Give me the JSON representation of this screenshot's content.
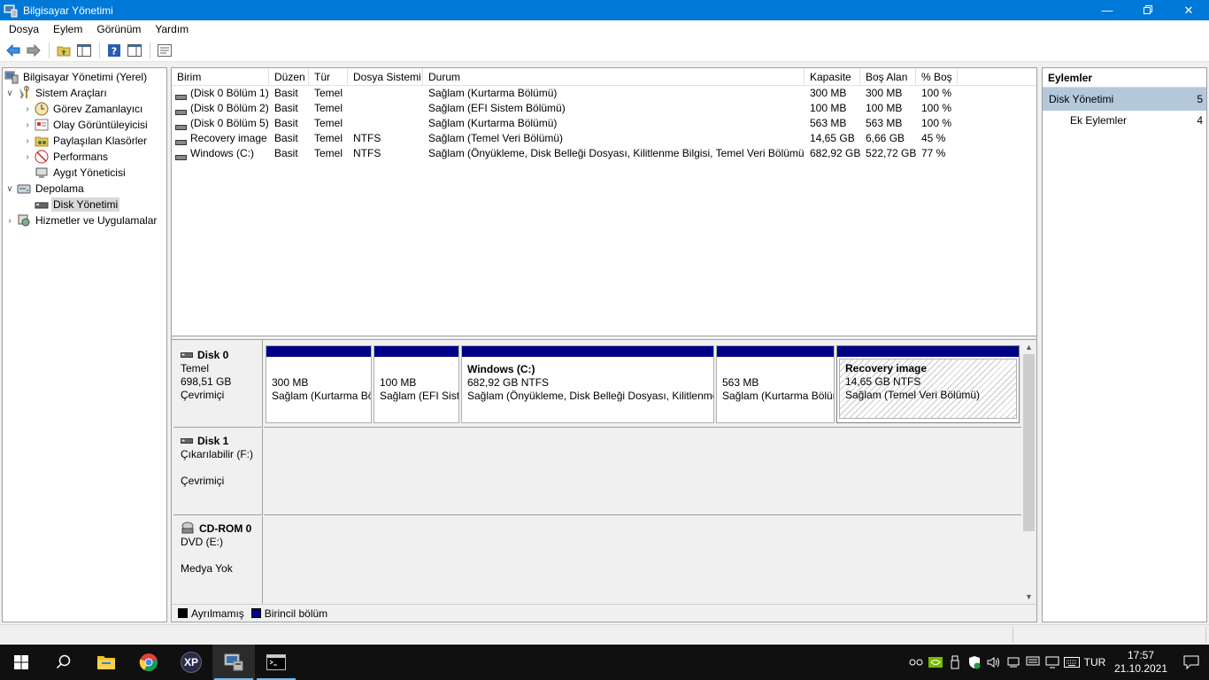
{
  "window": {
    "title": "Bilgisayar Yönetimi",
    "controls": [
      "minimize",
      "restore",
      "close"
    ]
  },
  "menu": [
    "Dosya",
    "Eylem",
    "Görünüm",
    "Yardım"
  ],
  "toolbar": {
    "buttons": [
      "back-icon",
      "forward-icon",
      "up-folder-icon",
      "show-hide-tree-icon",
      "help-icon",
      "show-hide-action-pane-icon",
      "properties-icon"
    ]
  },
  "tree": {
    "root": "Bilgisayar Yönetimi (Yerel)",
    "system_tools": "Sistem Araçları",
    "task_scheduler": "Görev Zamanlayıcı",
    "event_viewer": "Olay Görüntüleyicisi",
    "shared_folders": "Paylaşılan Klasörler",
    "performance": "Performans",
    "device_manager": "Aygıt Yöneticisi",
    "storage": "Depolama",
    "disk_management": "Disk Yönetimi",
    "services_apps": "Hizmetler ve Uygulamalar"
  },
  "volumes": {
    "headers": [
      "Birim",
      "Düzen",
      "Tür",
      "Dosya Sistemi",
      "Durum",
      "Kapasite",
      "Boş Alan",
      "% Boş"
    ],
    "rows": [
      [
        "(Disk 0 Bölüm 1)",
        "Basit",
        "Temel",
        "",
        "Sağlam (Kurtarma Bölümü)",
        "300 MB",
        "300 MB",
        "100 %"
      ],
      [
        "(Disk 0 Bölüm 2)",
        "Basit",
        "Temel",
        "",
        "Sağlam (EFI Sistem Bölümü)",
        "100 MB",
        "100 MB",
        "100 %"
      ],
      [
        "(Disk 0 Bölüm 5)",
        "Basit",
        "Temel",
        "",
        "Sağlam (Kurtarma Bölümü)",
        "563 MB",
        "563 MB",
        "100 %"
      ],
      [
        "Recovery image",
        "Basit",
        "Temel",
        "NTFS",
        "Sağlam (Temel Veri Bölümü)",
        "14,65 GB",
        "6,66 GB",
        "45 %"
      ],
      [
        "Windows (C:)",
        "Basit",
        "Temel",
        "NTFS",
        "Sağlam (Önyükleme, Disk Belleği Dosyası, Kilitlenme Bilgisi, Temel Veri Bölümü)",
        "682,92 GB",
        "522,72 GB",
        "77 %"
      ]
    ]
  },
  "disks": {
    "disk0": {
      "name": "Disk 0",
      "type": "Temel",
      "size": "698,51 GB",
      "status": "Çevrimiçi",
      "partitions": [
        {
          "title": "",
          "line1": "300 MB",
          "line2": "Sağlam (Kurtarma Bölümü)"
        },
        {
          "title": "",
          "line1": "100 MB",
          "line2": "Sağlam (EFI Sistem Bölümü)"
        },
        {
          "title": "Windows  (C:)",
          "line1": "682,92 GB NTFS",
          "line2": "Sağlam (Önyükleme, Disk Belleği Dosyası, Kilitlenme Bilgisi, Temel Veri Bölümü)"
        },
        {
          "title": "",
          "line1": "563 MB",
          "line2": "Sağlam (Kurtarma Bölümü)"
        },
        {
          "title": "Recovery image",
          "line1": "14,65 GB NTFS",
          "line2": "Sağlam (Temel Veri Bölümü)"
        }
      ]
    },
    "disk1": {
      "name": "Disk 1",
      "type": "Çıkarılabilir (F:)",
      "status": "Çevrimiçi"
    },
    "cdrom0": {
      "name": "CD-ROM 0",
      "type": "DVD (E:)",
      "status": "Medya Yok"
    }
  },
  "legend": {
    "unallocated": "Ayrılmamış",
    "primary": "Birincil bölüm",
    "unallocated_color": "#000000",
    "primary_color": "#000084"
  },
  "actions": {
    "header": "Eylemler",
    "section": "Disk Yönetimi",
    "section_arrow": "5",
    "more": "Ek Eylemler",
    "more_arrow": "4"
  },
  "taskbar": {
    "apps": [
      "windows-start-icon",
      "search-icon",
      "file-explorer-icon",
      "chrome-icon",
      "xp-app-icon",
      "computer-management-icon",
      "terminal-icon"
    ],
    "xp_label": "XP",
    "lang": "TUR",
    "time": "17:57",
    "date": "21.10.2021"
  },
  "colors": {
    "titlebar": "#0078d7",
    "selection": "#b4c8dc",
    "partition_bar": "#000084"
  }
}
